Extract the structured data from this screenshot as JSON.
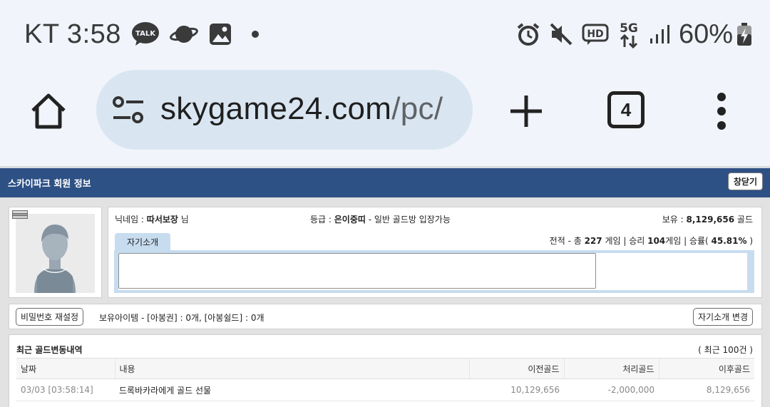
{
  "status_bar": {
    "carrier_time": "KT 3:58",
    "battery_percent": "60%",
    "left_icons": [
      "kakaotalk-icon",
      "planet-icon",
      "image-icon",
      "dot-icon"
    ],
    "right_icons": [
      "alarm-icon",
      "mute-icon",
      "hd-icon",
      "5g-icon",
      "signal-icon",
      "battery-charging-icon"
    ],
    "talk_badge": "TALK",
    "hd_label": "HD",
    "fiveg_label": "5G"
  },
  "browser": {
    "url_host": "skygame24.com",
    "url_path": "/pc/",
    "tab_count": "4"
  },
  "page": {
    "title": "스카이파크 회원 정보",
    "close_label": "창닫기",
    "nickname_label": "닉네임 : ",
    "nickname": "따서보장",
    "nickname_suffix": " 님",
    "grade_label": "등급 : ",
    "grade": "은이중띠",
    "grade_desc": " - 일반 골드방 입장가능",
    "gold_label": "보유 : ",
    "gold_amount": "8,129,656",
    "gold_unit": " 골드",
    "intro_tab": "자기소개",
    "record": {
      "prefix": "전적 - 총 ",
      "total": "227",
      "games_win_prefix": " 게임 | 승리 ",
      "wins": "104",
      "rate_prefix": "게임 | 승률( ",
      "rate": "45.81%",
      "rate_suffix": " )"
    },
    "reset_password_label": "비밀번호 재설정",
    "items_text": "보유아이템 - [아봉권] : 0개, [아봉쉴드] : 0개",
    "edit_intro_label": "자기소개 변경",
    "history": {
      "title": "최근 골드변동내역",
      "count_label": "( 최근 100건 )",
      "columns": [
        "날짜",
        "내용",
        "이전골드",
        "처리골드",
        "이후골드"
      ],
      "rows": [
        {
          "date": "03/03 [03:58:14]",
          "content": "드록바카라에게 골드 선물",
          "prev": "10,129,656",
          "change": "-2,000,000",
          "after": "8,129,656"
        }
      ]
    }
  }
}
